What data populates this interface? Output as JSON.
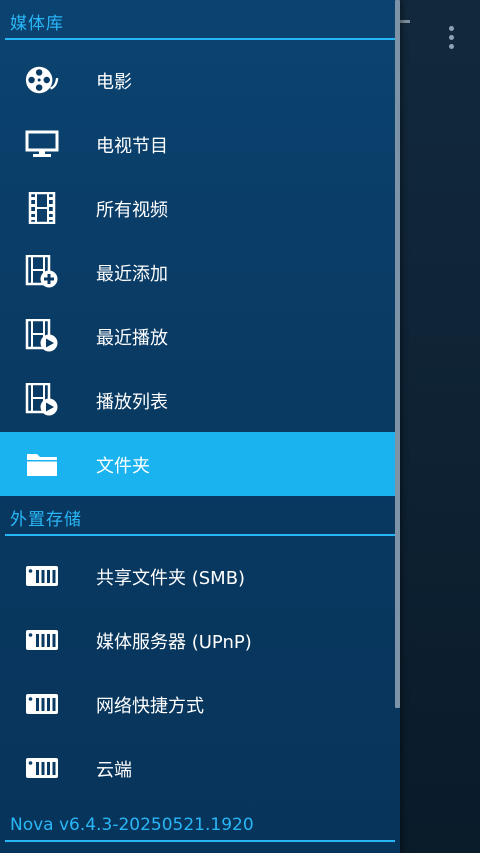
{
  "library": {
    "header": "媒体库",
    "items": [
      {
        "label": "电影",
        "icon": "film-reel-icon"
      },
      {
        "label": "电视节目",
        "icon": "tv-icon"
      },
      {
        "label": "所有视频",
        "icon": "film-strip-icon"
      },
      {
        "label": "最近添加",
        "icon": "film-add-icon"
      },
      {
        "label": "最近播放",
        "icon": "film-play-icon"
      },
      {
        "label": "播放列表",
        "icon": "playlist-icon"
      },
      {
        "label": "文件夹",
        "icon": "folder-icon",
        "selected": true
      }
    ]
  },
  "storage": {
    "header": "外置存储",
    "items": [
      {
        "label": "共享文件夹 (SMB)",
        "icon": "nas-icon"
      },
      {
        "label": "媒体服务器 (UPnP)",
        "icon": "nas-icon"
      },
      {
        "label": "网络快捷方式",
        "icon": "nas-icon"
      },
      {
        "label": "云端",
        "icon": "nas-icon"
      }
    ]
  },
  "footer": {
    "version": "Nova v6.4.3-20250521.1920"
  },
  "colors": {
    "accent": "#29b6f6",
    "selected": "#1ab3f0",
    "drawer": "#093a63"
  }
}
